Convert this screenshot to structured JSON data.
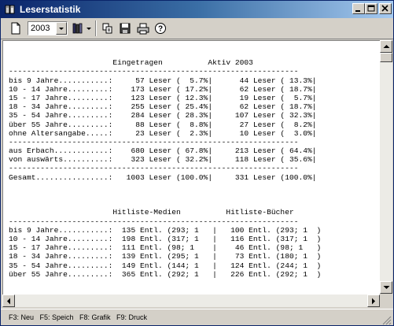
{
  "window": {
    "title": "Leserstatistik",
    "icon": "book-icon"
  },
  "toolbar": {
    "new_icon": "new-document-icon",
    "year_selected": "2003",
    "library_icon": "books-icon",
    "copy_icon": "copy-icon",
    "save_icon": "save-icon",
    "print_icon": "print-icon",
    "help_icon": "help-icon"
  },
  "report": {
    "lines": [
      "",
      "                       Eingetragen          Aktiv 2003",
      "----------------------------------------------------------------",
      "bis 9 Jahre...........:     57 Leser (  5.7%|      44 Leser ( 13.3%|",
      "10 - 14 Jahre.........:    173 Leser ( 17.2%|      62 Leser ( 18.7%|",
      "15 - 17 Jahre.........:    123 Leser ( 12.3%|      19 Leser (  5.7%|",
      "18 - 34 Jahre.........:    255 Leser ( 25.4%|      62 Leser ( 18.7%|",
      "35 - 54 Jahre.........:    284 Leser ( 28.3%|     107 Leser ( 32.3%|",
      "über 55 Jahre.........:     88 Leser (  8.8%|      27 Leser (  8.2%|",
      "ohne Altersangabe.....:     23 Leser (  2.3%|      10 Leser (  3.0%|",
      "----------------------------------------------------------------",
      "aus Erbach............:    680 Leser ( 67.8%|     213 Leser ( 64.4%|",
      "von auswärts..........:    323 Leser ( 32.2%|     118 Leser ( 35.6%|",
      "----------------------------------------------------------------",
      "Gesamt................:   1003 Leser (100.0%|     331 Leser (100.0%|",
      "",
      "",
      "",
      "                       Hitliste-Medien          Hitliste-Bücher",
      "----------------------------------------------------------------",
      "bis 9 Jahre...........:  135 Entl. (293; 1   |   100 Entl. (293; 1  )",
      "10 - 14 Jahre.........:  198 Entl. (317; 1   |   116 Entl. (317; 1  )",
      "15 - 17 Jahre.........:  111 Entl. (98; 1    |    46 Entl. (98; 1   )",
      "18 - 34 Jahre.........:  139 Entl. (295; 1   |    73 Entl. (180; 1  )",
      "35 - 54 Jahre.........:  149 Entl. (144; 1   |   124 Entl. (244; 1  )",
      "über 55 Jahre.........:  365 Entl. (292; 1   |   226 Entl. (292; 1  )"
    ]
  },
  "statusbar": {
    "text": "F3: Neu   F5: Speich   F8: Grafik   F9: Druck"
  }
}
